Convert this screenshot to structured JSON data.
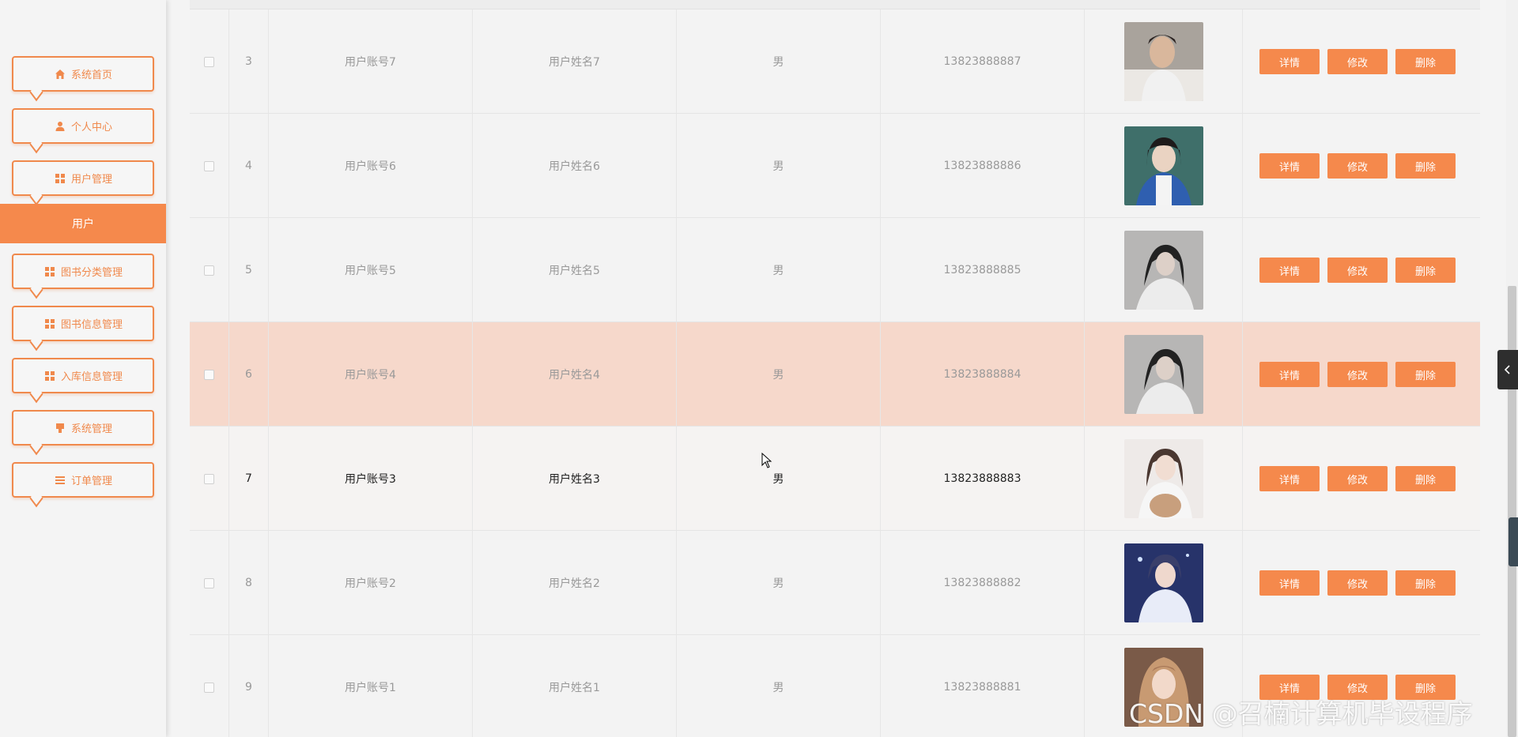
{
  "sidebar": {
    "items": [
      {
        "label": "系统首页",
        "icon": "home-icon"
      },
      {
        "label": "个人中心",
        "icon": "user-icon"
      },
      {
        "label": "用户管理",
        "icon": "grid-icon"
      },
      {
        "label": "图书分类管理",
        "icon": "grid-icon"
      },
      {
        "label": "图书信息管理",
        "icon": "grid-icon"
      },
      {
        "label": "入库信息管理",
        "icon": "grid-icon"
      },
      {
        "label": "系统管理",
        "icon": "system-icon"
      },
      {
        "label": "订单管理",
        "icon": "list-icon"
      }
    ],
    "active_sub": "用户"
  },
  "table": {
    "buttons": {
      "detail": "详情",
      "edit": "修改",
      "delete": "删除"
    },
    "rows": [
      {
        "idx": "3",
        "account": "用户账号7",
        "name": "用户姓名7",
        "sex": "男",
        "phone": "13823888887"
      },
      {
        "idx": "4",
        "account": "用户账号6",
        "name": "用户姓名6",
        "sex": "男",
        "phone": "13823888886"
      },
      {
        "idx": "5",
        "account": "用户账号5",
        "name": "用户姓名5",
        "sex": "男",
        "phone": "13823888885"
      },
      {
        "idx": "6",
        "account": "用户账号4",
        "name": "用户姓名4",
        "sex": "男",
        "phone": "13823888884"
      },
      {
        "idx": "7",
        "account": "用户账号3",
        "name": "用户姓名3",
        "sex": "男",
        "phone": "13823888883"
      },
      {
        "idx": "8",
        "account": "用户账号2",
        "name": "用户姓名2",
        "sex": "男",
        "phone": "13823888882"
      },
      {
        "idx": "9",
        "account": "用户账号1",
        "name": "用户姓名1",
        "sex": "男",
        "phone": "13823888881"
      }
    ]
  },
  "watermark": "CSDN @召楠计算机毕设程序",
  "colors": {
    "accent": "#f5894c",
    "highlight_row": "#f6d8cb"
  }
}
